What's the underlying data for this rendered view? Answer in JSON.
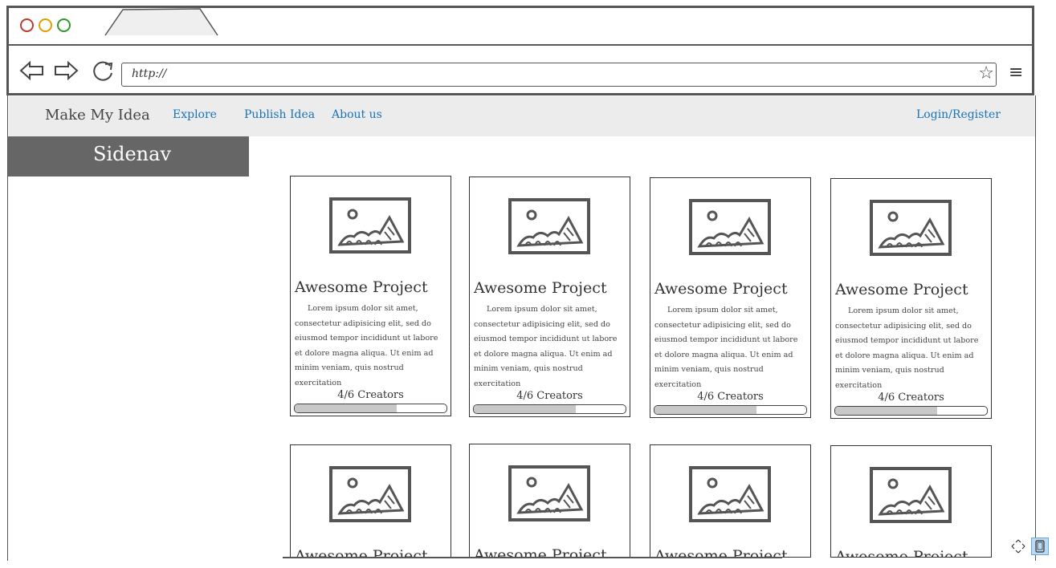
{
  "browser": {
    "url": "http://",
    "controls": [
      "back-arrow-icon",
      "forward-arrow-icon",
      "reload-icon",
      "star-icon",
      "hamburger-menu-icon"
    ]
  },
  "nav": {
    "brand": "Make My Idea",
    "links": [
      "Explore",
      "Publish Idea",
      "About us"
    ],
    "login": "Login/Register",
    "link_color": "#1a73b5"
  },
  "sidenav": {
    "label": "Sidenav"
  },
  "cards": [
    {
      "title": "Awesome Project",
      "description": "Lorem ipsum dolor sit amet, consectetur adipisicing elit, sed do eiusmod tempor incididunt ut labore et dolore magna aliqua. Ut enim ad minim veniam, quis nostrud exercitation",
      "creators": "4/6 Creators",
      "progress": 0.67
    },
    {
      "title": "Awesome Project",
      "description": "Lorem ipsum dolor sit amet, consectetur adipisicing elit, sed do eiusmod tempor incididunt ut labore et dolore magna aliqua. Ut enim ad minim veniam, quis nostrud exercitation",
      "creators": "4/6 Creators",
      "progress": 0.67
    },
    {
      "title": "Awesome Project",
      "description": "Lorem ipsum dolor sit amet, consectetur adipisicing elit, sed do eiusmod tempor incididunt ut labore et dolore magna aliqua. Ut enim ad minim veniam, quis nostrud exercitation",
      "creators": "4/6 Creators",
      "progress": 0.67
    },
    {
      "title": "Awesome Project",
      "description": "Lorem ipsum dolor sit amet, consectetur adipisicing elit, sed do eiusmod tempor incididunt ut labore et dolore magna aliqua. Ut enim ad minim veniam, quis nostrud exercitation",
      "creators": "4/6 Creators",
      "progress": 0.67
    },
    {
      "title": "Awesome Project"
    },
    {
      "title": "Awesome Project"
    },
    {
      "title": "Awesome Project"
    },
    {
      "title": "Awesome Project"
    }
  ]
}
